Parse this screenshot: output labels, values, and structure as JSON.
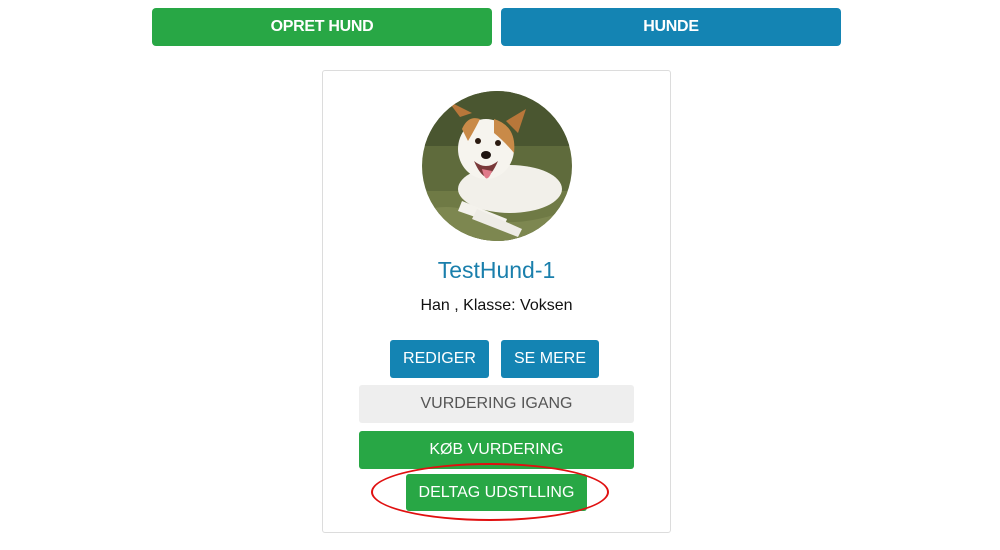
{
  "nav": {
    "create_dog_label": "OPRET HUND",
    "dogs_label": "HUNDE"
  },
  "dog_card": {
    "name": "TestHund-1",
    "info": "Han , Klasse: Voksen",
    "edit_label": "REDIGER",
    "see_more_label": "SE MERE",
    "status_label": "VURDERING IGANG",
    "buy_evaluation_label": "KØB VURDERING",
    "join_exhibition_label": "DELTAG UDSTLLING"
  },
  "colors": {
    "green": "#28a745",
    "blue": "#1484b3",
    "name_blue": "#1a7fac",
    "highlight_red": "#e01010",
    "status_grey": "#eeeeee"
  }
}
